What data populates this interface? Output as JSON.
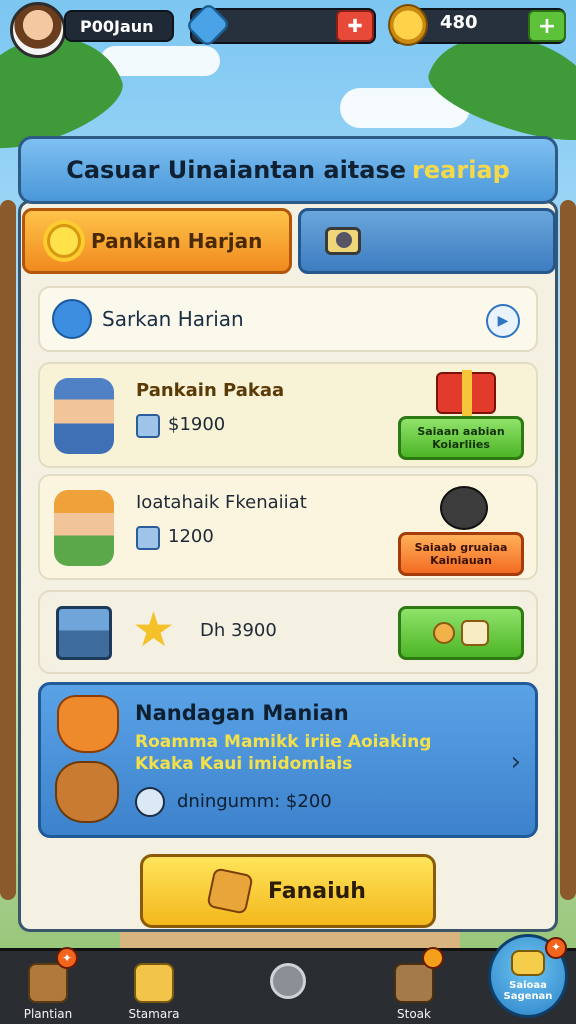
{
  "topbar": {
    "player_name": "P00Jaun",
    "coins": "480",
    "gem_plus": "✚",
    "coin_plus": "+"
  },
  "panel": {
    "title": "Casuar Uinaiantan aitase",
    "title_highlight": "reariap"
  },
  "tabs": [
    {
      "label": "Pankian Harjan",
      "active": true,
      "icon": "sun-icon"
    },
    {
      "label": "",
      "active": false,
      "icon": "camera-icon"
    }
  ],
  "daily": {
    "label": "Sarkan Harian",
    "play_icon": "▶"
  },
  "missions": [
    {
      "title": "Pankain Pakaa",
      "reward": "$1900",
      "button": "Saiaan aabian Koiarliies",
      "button_color": "#4db526"
    },
    {
      "title": "Ioatahaik Fkenaiiat",
      "reward": "1200",
      "button": "Saiaab gruaiaa Kainiauan",
      "button_color": "#f36b22"
    },
    {
      "title": "",
      "reward": "Dh 3900",
      "button": "",
      "button_color": "#4db526"
    }
  ],
  "promo": {
    "title": "Nandagan Manian",
    "subtitle": "Roamma Mamikk iriie Aoiaking Kkaka Kaui imidomlais",
    "reward": "dningumm: $200",
    "chevron": "›"
  },
  "main_button": {
    "label": "Fanaiuh"
  },
  "bottom_nav": [
    {
      "label": "Plantian",
      "badge": "✦",
      "icon": "house-icon"
    },
    {
      "label": "Stamara",
      "badge": "",
      "icon": "potion-icon"
    },
    {
      "label": "",
      "badge": "",
      "icon": "circle-icon"
    },
    {
      "label": "Stoak",
      "badge": "",
      "icon": "crate-icon"
    },
    {
      "label": "Saioaa Sagenan",
      "badge": "✦",
      "icon": "gold-icon"
    }
  ],
  "colors": {
    "accent_orange": "#f08a1e",
    "accent_blue": "#3d82cc",
    "accent_green": "#4db526",
    "panel_bg": "#f4f0e2"
  }
}
